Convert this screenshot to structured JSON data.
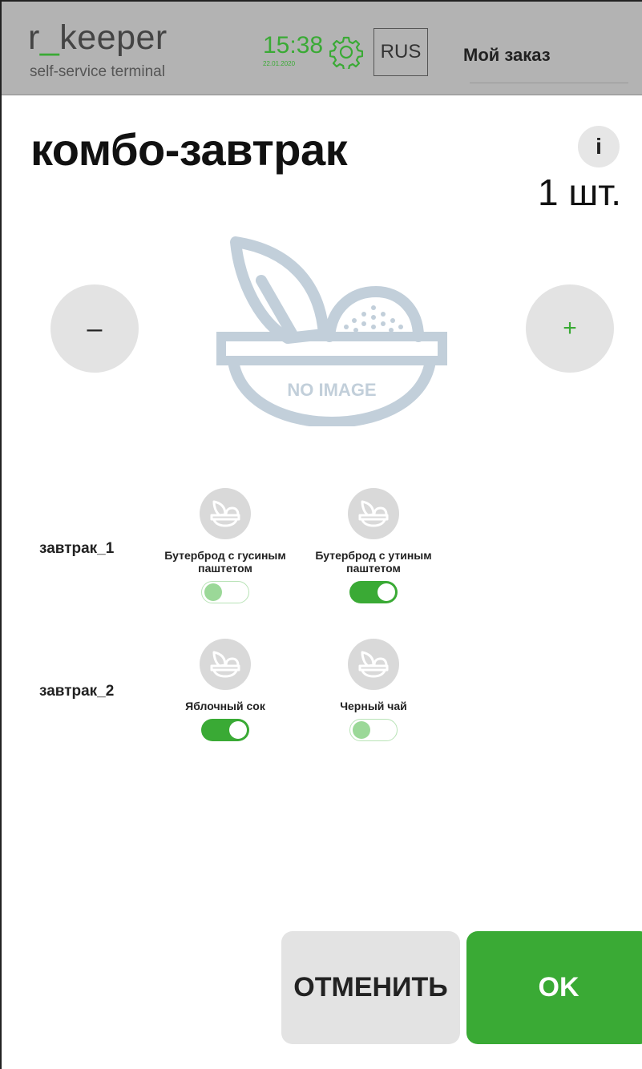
{
  "header": {
    "logo_prefix": "r",
    "logo_underscore": "_",
    "logo_suffix": "keeper",
    "logo_subtitle": "self-service terminal",
    "time": "15:38",
    "date": "22.01.2020",
    "settings_icon": "gear-icon",
    "language": "RUS",
    "order_title": "Мой заказ"
  },
  "product": {
    "title": "комбо-завтрак",
    "info_label": "i",
    "quantity": "1 шт.",
    "minus_label": "–",
    "plus_label": "+",
    "image_alt": "NO IMAGE",
    "image_icon": "no-image-bowl-icon"
  },
  "groups": [
    {
      "label": "завтрак_1",
      "options": [
        {
          "name": "Бутерброд с гусиным паштетом",
          "selected": false
        },
        {
          "name": "Бутерброд с утиным паштетом",
          "selected": true
        }
      ]
    },
    {
      "label": "завтрак_2",
      "options": [
        {
          "name": "Яблочный сок",
          "selected": true
        },
        {
          "name": "Черный чай",
          "selected": false
        }
      ]
    }
  ],
  "actions": {
    "cancel_label": "ОТМЕНИТЬ",
    "ok_label": "OK"
  },
  "colors": {
    "accent": "#3aaa35",
    "header_bg": "#b3b3b3",
    "button_gray": "#e3e3e3",
    "placeholder": "#c2cfda"
  }
}
